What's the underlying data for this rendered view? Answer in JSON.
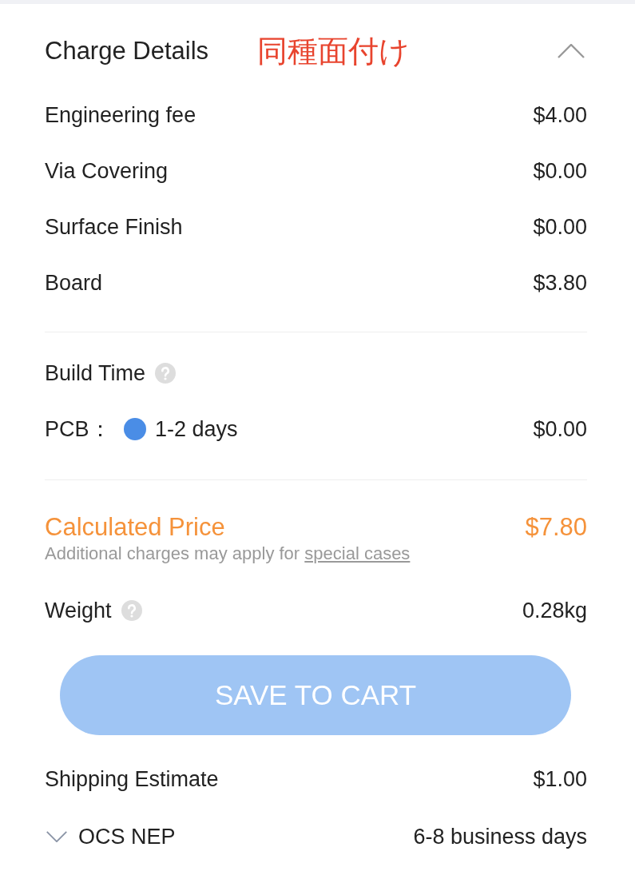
{
  "charge_details": {
    "title": "Charge Details",
    "annotation": "同種面付け",
    "expanded": true,
    "items": [
      {
        "label": "Engineering fee",
        "value": "$4.00"
      },
      {
        "label": "Via Covering",
        "value": "$0.00"
      },
      {
        "label": "Surface Finish",
        "value": "$0.00"
      },
      {
        "label": "Board",
        "value": "$3.80"
      }
    ]
  },
  "build_time": {
    "label": "Build Time",
    "options": [
      {
        "label": "PCB：",
        "option": "1-2 days",
        "selected": true,
        "price": "$0.00"
      }
    ]
  },
  "calculated_price": {
    "label": "Calculated Price",
    "value": "$7.80",
    "note": "Additional charges may apply for ",
    "note_link": "special cases"
  },
  "weight": {
    "label": "Weight",
    "value": "0.28kg"
  },
  "save_button": {
    "label": "SAVE TO CART",
    "disabled": true
  },
  "shipping": {
    "label": "Shipping Estimate",
    "value": "$1.00",
    "method": {
      "name": "OCS NEP",
      "time": "6-8 business days",
      "expanded": false
    }
  }
}
